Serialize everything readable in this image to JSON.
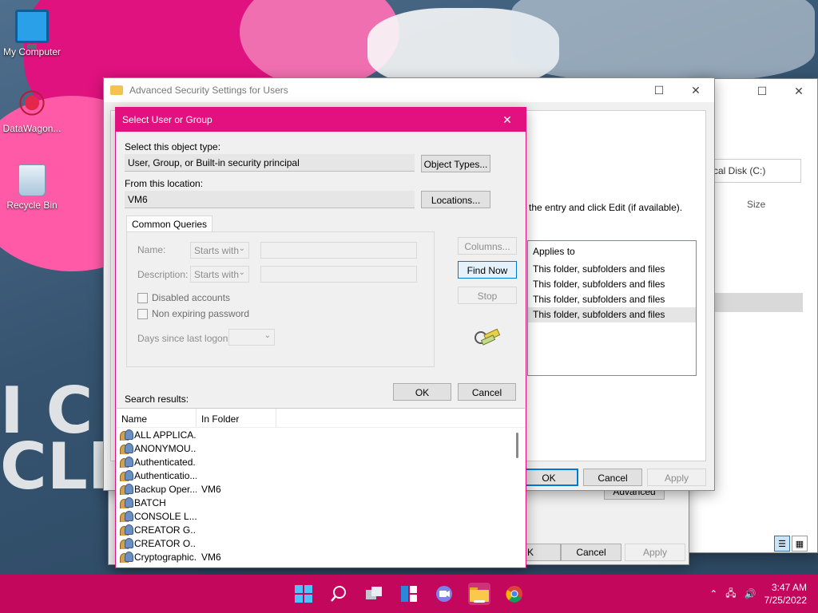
{
  "desktop": {
    "icons": [
      {
        "label": "My Computer"
      },
      {
        "label": "DataWagon..."
      },
      {
        "label": "Recycle Bin"
      }
    ],
    "wallpaper_text": [
      "I C",
      "CLP"
    ]
  },
  "explorer": {
    "address": "cal Disk (C:)",
    "size_header": "Size"
  },
  "props": {
    "ok_fragment": "K",
    "cancel_label": "Cancel",
    "apply_label": "Apply",
    "advanced_label": "Advanced"
  },
  "advanced": {
    "title": "Advanced Security Settings for Users",
    "hint": "the entry and click Edit (if available).",
    "list_header": "Applies to",
    "list_rows": [
      "This folder, subfolders and files",
      "This folder, subfolders and files",
      "This folder, subfolders and files",
      "This folder, subfolders and files"
    ],
    "ok_label": "OK",
    "cancel_label": "Cancel",
    "apply_label": "Apply"
  },
  "dialog": {
    "title": "Select User or Group",
    "object_type_label": "Select this object type:",
    "object_type_value": "User, Group, or Built-in security principal",
    "object_types_button": "Object Types...",
    "location_label": "From this location:",
    "location_value": "VM6",
    "locations_button": "Locations...",
    "tab_label": "Common Queries",
    "name_label": "Name:",
    "name_mode": "Starts with",
    "description_label": "Description:",
    "description_mode": "Starts with",
    "disabled_accounts": "Disabled accounts",
    "non_expiring": "Non expiring password",
    "days_label": "Days since last logon:",
    "columns_button": "Columns...",
    "find_now_button": "Find Now",
    "stop_button": "Stop",
    "ok_button": "OK",
    "cancel_button": "Cancel",
    "search_results_label": "Search results:",
    "results_columns": [
      "Name",
      "In Folder"
    ],
    "results": [
      {
        "name": "ALL APPLICA...",
        "folder": ""
      },
      {
        "name": "ANONYMOU...",
        "folder": ""
      },
      {
        "name": "Authenticated...",
        "folder": ""
      },
      {
        "name": "Authenticatio...",
        "folder": ""
      },
      {
        "name": "Backup Oper...",
        "folder": "VM6"
      },
      {
        "name": "BATCH",
        "folder": ""
      },
      {
        "name": "CONSOLE L...",
        "folder": ""
      },
      {
        "name": "CREATOR G...",
        "folder": ""
      },
      {
        "name": "CREATOR O...",
        "folder": ""
      },
      {
        "name": "Cryptographic...",
        "folder": "VM6"
      }
    ]
  },
  "taskbar": {
    "time": "3:47 AM",
    "date": "7/25/2022",
    "icons": [
      "windows-start-icon",
      "search-icon",
      "task-view-icon",
      "widgets-icon",
      "chat-icon",
      "file-explorer-icon",
      "chrome-icon"
    ]
  },
  "colors": {
    "accent": "#e3107f",
    "taskbar": "#c2075c"
  }
}
